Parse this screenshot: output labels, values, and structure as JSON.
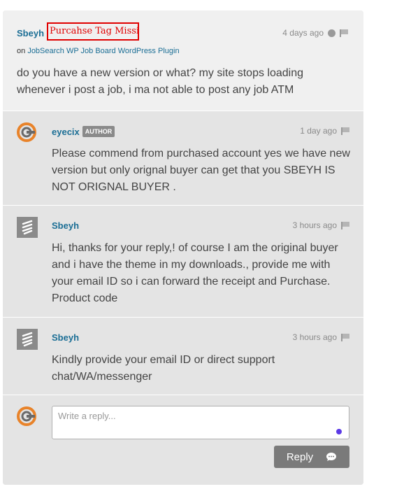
{
  "question": {
    "author": "Sbeyh",
    "tag_annotation": "Purcahse Tag Missing",
    "time": "4 days ago",
    "on_label": "on",
    "product": "JobSearch WP Job Board WordPress Plugin",
    "body": "do you have a new version or what? my site stops loading whenever i post a job, i ma not able to post any job ATM"
  },
  "replies": [
    {
      "author": "eyecix",
      "badge": "AUTHOR",
      "time": "1 day ago",
      "body": "Please commend from purchased account yes we have new version but only orignal buyer can get that you SBEYH IS NOT ORIGNAL BUYER ."
    },
    {
      "author": "Sbeyh",
      "time": "3 hours ago",
      "body": "Hi, thanks for your reply,! of course I am the original buyer and i have the theme in my downloads., provide me with your email ID so i can forward the receipt and Purchase. Product code"
    },
    {
      "author": "Sbeyh",
      "time": "3 hours ago",
      "body": "Kindly provide your email ID or direct support chat/WA/messenger"
    }
  ],
  "compose": {
    "placeholder": "Write a reply...",
    "button_label": "Reply",
    "button_icon": "speech-bubble-icon"
  },
  "colors": {
    "author_link": "#1b6e95",
    "annotation_red": "#e00000",
    "brand_orange": "#e8832a",
    "button_gray": "#7a7a7a"
  }
}
